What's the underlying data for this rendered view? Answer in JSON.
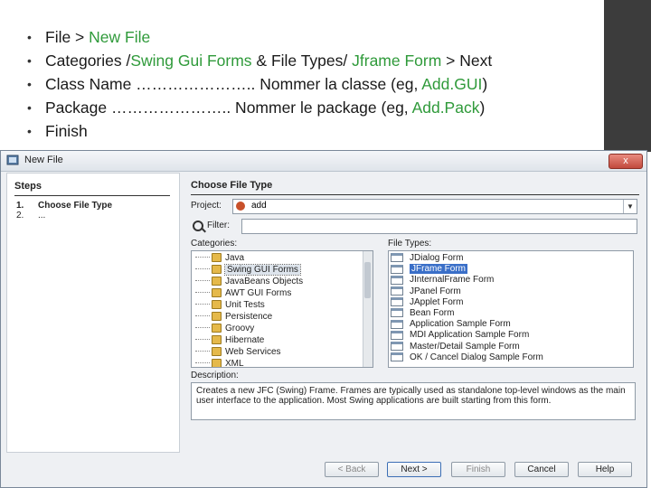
{
  "slide": {
    "bullets": [
      {
        "parts": [
          {
            "text": "File > ",
            "accent": false
          },
          {
            "text": "New File",
            "accent": true
          }
        ]
      },
      {
        "parts": [
          {
            "text": "Categories /",
            "accent": false
          },
          {
            "text": "Swing Gui Forms",
            "accent": true
          },
          {
            "text": " &     File Types/ ",
            "accent": false
          },
          {
            "text": "Jframe Form",
            "accent": true
          },
          {
            "text": "   >   Next",
            "accent": false
          }
        ]
      },
      {
        "parts": [
          {
            "text": "Class Name ………………….. Nommer la classe (eg, ",
            "accent": false
          },
          {
            "text": "Add.GUI",
            "accent": true
          },
          {
            "text": ")",
            "accent": false
          }
        ]
      },
      {
        "parts": [
          {
            "text": "Package ………………….. Nommer le package (eg, ",
            "accent": false
          },
          {
            "text": "Add.Pack",
            "accent": true
          },
          {
            "text": ")",
            "accent": false
          }
        ]
      },
      {
        "parts": [
          {
            "text": "Finish",
            "accent": false
          }
        ]
      }
    ],
    "bullet_char": "•",
    "accent_color": "#2f9a3a"
  },
  "dialog": {
    "title": "New File",
    "close_label": "x",
    "steps": {
      "heading": "Steps",
      "items": [
        {
          "num": "1.",
          "label": "Choose File Type",
          "active": true
        },
        {
          "num": "2.",
          "label": "...",
          "active": false
        }
      ]
    },
    "main": {
      "heading": "Choose File Type",
      "project_label": "Project:",
      "project_value": "add",
      "filter_label": "Filter:",
      "filter_value": "",
      "categories_label": "Categories:",
      "categories": [
        "Java",
        "Swing GUI Forms",
        "JavaBeans Objects",
        "AWT GUI Forms",
        "Unit Tests",
        "Persistence",
        "Groovy",
        "Hibernate",
        "Web Services",
        "XML"
      ],
      "selected_category": 1,
      "file_types_label": "File Types:",
      "file_types": [
        "JDialog Form",
        "JFrame Form",
        "JInternalFrame Form",
        "JPanel Form",
        "JApplet Form",
        "Bean Form",
        "Application Sample Form",
        "MDI Application Sample Form",
        "Master/Detail Sample Form",
        "OK / Cancel Dialog Sample Form"
      ],
      "selected_file_type": 1,
      "description_label": "Description:",
      "description": "Creates a new JFC (Swing) Frame. Frames are typically used as standalone top-level windows as the main user interface to the application. Most Swing applications are built starting from this form."
    },
    "buttons": {
      "back": "< Back",
      "next": "Next >",
      "finish": "Finish",
      "cancel": "Cancel",
      "help": "Help"
    }
  }
}
